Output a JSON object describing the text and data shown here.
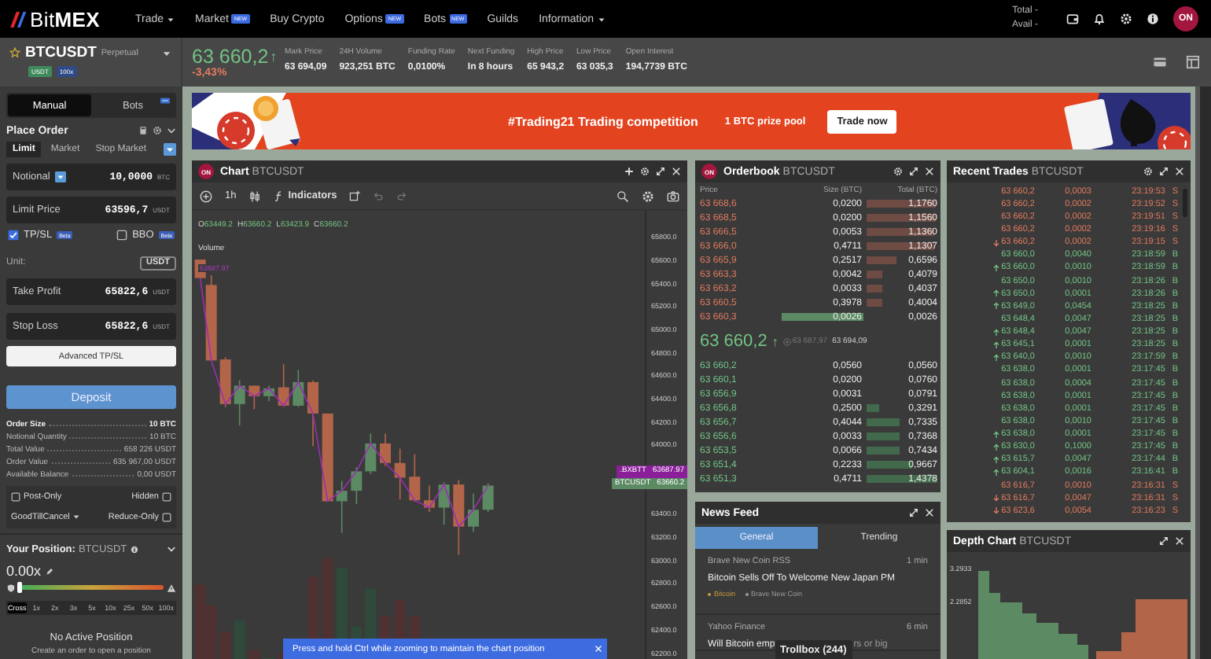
{
  "nav": {
    "logo": "Bit**MEX**",
    "items": [
      {
        "label": "Trade",
        "dropdown": true
      },
      {
        "label": "Market",
        "dropdown": false,
        "badge": "NEW"
      },
      {
        "label": "Buy Crypto",
        "dropdown": false
      },
      {
        "label": "Options",
        "dropdown": false,
        "badge": "NEW"
      },
      {
        "label": "Bots",
        "dropdown": false,
        "badge": "NEW"
      },
      {
        "label": "Guilds",
        "dropdown": false
      },
      {
        "label": "Information",
        "dropdown": true
      }
    ],
    "balances": [
      "Total -",
      "Avail -"
    ],
    "avatar": "ON"
  },
  "ticker": {
    "symbol": "BTCUSDT",
    "type": "Perpetual",
    "tags": [
      {
        "label": "USDT",
        "color": "#3f8a5c"
      },
      {
        "label": "100x",
        "color": "#2f4a86"
      }
    ],
    "price": "63 660,2",
    "rising": true,
    "arrow": "↑",
    "change": "-3,43%",
    "stats": [
      {
        "label": "Mark Price",
        "value": "63 694,09"
      },
      {
        "label": "24H Volume",
        "value": "923,251 BTC"
      },
      {
        "label": "Funding Rate",
        "value": "0,0100%"
      },
      {
        "label": "Next Funding",
        "value": "In 8 hours"
      },
      {
        "label": "High Price",
        "value": "65 943,2"
      },
      {
        "label": "Low Price",
        "value": "63 035,3"
      },
      {
        "label": "Open Interest",
        "value": "194,7739 BTC"
      }
    ]
  },
  "banner": {
    "title": "#Trading21 Trading competition",
    "prize": "1 BTC prize pool",
    "button": "Trade now"
  },
  "order": {
    "tabs": [
      {
        "label": "Manual",
        "selected": true
      },
      {
        "label": "Bots",
        "selected": false
      }
    ],
    "title": "Place Order",
    "types": [
      {
        "label": "Limit",
        "selected": true
      },
      {
        "label": "Market",
        "selected": false
      },
      {
        "label": "Stop Market",
        "selected": false
      }
    ],
    "fields": [
      {
        "label": "Notional",
        "value": "10,0000",
        "unit": "BTC",
        "dropdown": true
      },
      {
        "label": "Limit Price",
        "value": "63596,7",
        "unit": "USDT",
        "dropdown": false
      }
    ],
    "options": [
      {
        "label": "TP/SL",
        "checked": true,
        "badge": "Beta"
      },
      {
        "label": "BBO",
        "checked": false,
        "badge": "Beta"
      }
    ],
    "unit": {
      "label": "Unit:",
      "value": "USDT"
    },
    "tp_fields": [
      {
        "label": "Take Profit",
        "value": "65822,6",
        "unit": "USDT"
      },
      {
        "label": "Stop Loss",
        "value": "65822,6",
        "unit": "USDT"
      }
    ],
    "advanced_button": "Advanced TP/SL",
    "deposit_button": "Deposit",
    "summary": [
      {
        "label": "Order Size",
        "value": "10 BTC",
        "bold": true
      },
      {
        "label": "Notional Quantity",
        "value": "10 BTC",
        "bold": false
      },
      {
        "label": "Total Value",
        "value": "658 226 USDT",
        "bold": false
      },
      {
        "label": "Order Value",
        "value": "635 967,00 USDT",
        "bold": false
      },
      {
        "label": "Available Balance",
        "value": "0,00 USDT",
        "bold": false
      }
    ],
    "flags": [
      {
        "kind": "box-left",
        "label": "Post-Only",
        "checked": false
      },
      {
        "kind": "box-right",
        "label": "Hidden",
        "checked": false
      },
      {
        "kind": "dropdown",
        "label": "GoodTillCancel"
      },
      {
        "kind": "box-right",
        "label": "Reduce-Only",
        "checked": false
      }
    ]
  },
  "position": {
    "label": "Your Position:",
    "symbol": "BTCUSDT",
    "leverage": "0.00x",
    "level": 0,
    "leverage_options": [
      {
        "label": "Cross",
        "selected": true
      },
      {
        "label": "1x",
        "selected": false
      },
      {
        "label": "2x",
        "selected": false
      },
      {
        "label": "3x",
        "selected": false
      },
      {
        "label": "5x",
        "selected": false
      },
      {
        "label": "10x",
        "selected": false
      },
      {
        "label": "25x",
        "selected": false
      },
      {
        "label": "50x",
        "selected": false
      },
      {
        "label": "100x",
        "selected": false
      }
    ],
    "empty_title": "No Active Position",
    "empty_hint": "Create an order to open a position"
  },
  "chart": {
    "badge": "ON",
    "title": "Chart",
    "symbol": "BTCUSDT",
    "interval": "1h",
    "indicators": "Indicators",
    "ohlc": [
      {
        "key": "O",
        "value": "63449.2"
      },
      {
        "key": "H",
        "value": "63660.2"
      },
      {
        "key": "L",
        "value": "63423.9"
      },
      {
        "key": "C",
        "value": "63660.2"
      }
    ],
    "volume_label": "Volume",
    "marker": "63687.97",
    "axis": [
      "65800.0",
      "65600.0",
      "65400.0",
      "65200.0",
      "65000.0",
      "64800.0",
      "64600.0",
      "64400.0",
      "64200.0",
      "64000.0",
      "63400.0",
      "63200.0",
      "63000.0",
      "62800.0",
      "62600.0",
      "62400.0",
      "62200.0"
    ],
    "tags": [
      {
        "label": ".BXBTT",
        "value": "63687.97",
        "color": "#8a1f99"
      },
      {
        "label": "BTCUSDT",
        "value": "63660.2",
        "color": "#5b8a63"
      }
    ],
    "hint": "Press and hold Ctrl while zooming to maintain the chart position"
  },
  "orderbook": {
    "badge": "ON",
    "title": "Orderbook",
    "symbol": "BTCUSDT",
    "columns": [
      "Price",
      "Size (BTC)",
      "Total (BTC)"
    ],
    "asks": [
      {
        "price": "63 668,6",
        "size": "0,0200",
        "total": "1,1760",
        "own": false
      },
      {
        "price": "63 668,5",
        "size": "0,0200",
        "total": "1,1560",
        "own": false
      },
      {
        "price": "63 666,5",
        "size": "0,0053",
        "total": "1,1360",
        "own": false
      },
      {
        "price": "63 666,0",
        "size": "0,4711",
        "total": "1,1307",
        "own": false
      },
      {
        "price": "63 665,9",
        "size": "0,2517",
        "total": "0,6596",
        "own": false
      },
      {
        "price": "63 663,3",
        "size": "0,0042",
        "total": "0,4079",
        "own": false
      },
      {
        "price": "63 663,2",
        "size": "0,0033",
        "total": "0,4037",
        "own": false
      },
      {
        "price": "63 660,5",
        "size": "0,3978",
        "total": "0,4004",
        "own": false
      },
      {
        "price": "63 660,3",
        "size": "0,0026",
        "total": "0,0026",
        "own": true
      }
    ],
    "last": {
      "price": "63 660,2",
      "rising": true,
      "arrow": "↑",
      "index": "63 687,97",
      "mark": "63 694,09"
    },
    "bids": [
      {
        "price": "63 660,2",
        "size": "0,0560",
        "total": "0,0560"
      },
      {
        "price": "63 660,1",
        "size": "0,0200",
        "total": "0,0760"
      },
      {
        "price": "63 656,9",
        "size": "0,0031",
        "total": "0,0791"
      },
      {
        "price": "63 656,8",
        "size": "0,2500",
        "total": "0,3291"
      },
      {
        "price": "63 656,7",
        "size": "0,4044",
        "total": "0,7335"
      },
      {
        "price": "63 656,6",
        "size": "0,0033",
        "total": "0,7368"
      },
      {
        "price": "63 653,5",
        "size": "0,0066",
        "total": "0,7434"
      },
      {
        "price": "63 651,4",
        "size": "0,2233",
        "total": "0,9667"
      },
      {
        "price": "63 651,3",
        "size": "0,4711",
        "total": "1,4378"
      }
    ]
  },
  "news": {
    "title": "News Feed",
    "tabs": [
      {
        "label": "General",
        "selected": true
      },
      {
        "label": "Trending",
        "selected": false
      }
    ],
    "items": [
      {
        "source": "Brave New Coin RSS",
        "age": "1 min",
        "title": "Bitcoin Sells Off To Welcome New Japan PM",
        "tags": [
          {
            "label": "Bitcoin",
            "color": "#c99a3e"
          },
          {
            "label": "Brave New Coin",
            "color": "#9a9a9a"
          }
        ]
      },
      {
        "source": "Yahoo Finance",
        "age": "6 min",
        "title": "Will Bitcoin emp",
        "title_after": "rs or big"
      }
    ]
  },
  "trollbox": "Trollbox (244)",
  "trades": {
    "title": "Recent Trades",
    "symbol": "BTCUSDT",
    "rows": [
      {
        "price": "63 660,2",
        "size": "0,0003",
        "time": "23:19:53",
        "side": "S",
        "kind": "sell",
        "tick": false
      },
      {
        "price": "63 660,2",
        "size": "0,0002",
        "time": "23:19:52",
        "side": "S",
        "kind": "sell",
        "tick": false
      },
      {
        "price": "63 660,2",
        "size": "0,0002",
        "time": "23:19:51",
        "side": "S",
        "kind": "sell",
        "tick": false
      },
      {
        "price": "63 660,2",
        "size": "0,0002",
        "time": "23:19:16",
        "side": "S",
        "kind": "sell",
        "tick": false
      },
      {
        "price": "63 660,2",
        "size": "0,0002",
        "time": "23:19:15",
        "side": "S",
        "kind": "sell",
        "tick": true
      },
      {
        "price": "63 660,0",
        "size": "0,0040",
        "time": "23:18:59",
        "side": "B",
        "kind": "buy",
        "tick": false
      },
      {
        "price": "63 660,0",
        "size": "0,0010",
        "time": "23:18:59",
        "side": "B",
        "kind": "buy",
        "tick": true
      },
      {
        "price": "63 650,0",
        "size": "0,0010",
        "time": "23:18:26",
        "side": "B",
        "kind": "buy",
        "tick": false
      },
      {
        "price": "63 650,0",
        "size": "0,0001",
        "time": "23:18:26",
        "side": "B",
        "kind": "buy",
        "tick": true
      },
      {
        "price": "63 649,0",
        "size": "0,0454",
        "time": "23:18:25",
        "side": "B",
        "kind": "buy",
        "tick": true
      },
      {
        "price": "63 648,4",
        "size": "0,0047",
        "time": "23:18:25",
        "side": "B",
        "kind": "buy",
        "tick": false
      },
      {
        "price": "63 648,4",
        "size": "0,0047",
        "time": "23:18:25",
        "side": "B",
        "kind": "buy",
        "tick": true
      },
      {
        "price": "63 645,1",
        "size": "0,0001",
        "time": "23:18:25",
        "side": "B",
        "kind": "buy",
        "tick": true
      },
      {
        "price": "63 640,0",
        "size": "0,0010",
        "time": "23:17:59",
        "side": "B",
        "kind": "buy",
        "tick": true
      },
      {
        "price": "63 638,0",
        "size": "0,0001",
        "time": "23:17:45",
        "side": "B",
        "kind": "buy",
        "tick": false
      },
      {
        "price": "63 638,0",
        "size": "0,0004",
        "time": "23:17:45",
        "side": "B",
        "kind": "buy",
        "tick": false
      },
      {
        "price": "63 638,0",
        "size": "0,0001",
        "time": "23:17:45",
        "side": "B",
        "kind": "buy",
        "tick": false
      },
      {
        "price": "63 638,0",
        "size": "0,0001",
        "time": "23:17:45",
        "side": "B",
        "kind": "buy",
        "tick": false
      },
      {
        "price": "63 638,0",
        "size": "0,0010",
        "time": "23:17:45",
        "side": "B",
        "kind": "buy",
        "tick": false
      },
      {
        "price": "63 638,0",
        "size": "0,0001",
        "time": "23:17:45",
        "side": "B",
        "kind": "buy",
        "tick": true
      },
      {
        "price": "63 630,0",
        "size": "0,1000",
        "time": "23:17:45",
        "side": "B",
        "kind": "buy",
        "tick": true
      },
      {
        "price": "63 615,7",
        "size": "0,0047",
        "time": "23:17:44",
        "side": "B",
        "kind": "buy",
        "tick": true
      },
      {
        "price": "63 604,1",
        "size": "0,0016",
        "time": "23:16:41",
        "side": "B",
        "kind": "buy",
        "tick": true
      },
      {
        "price": "63 616,7",
        "size": "0,0010",
        "time": "23:16:31",
        "side": "S",
        "kind": "sell",
        "tick": false
      },
      {
        "price": "63 616,7",
        "size": "0,0047",
        "time": "23:16:31",
        "side": "S",
        "kind": "sell",
        "tick": true
      },
      {
        "price": "63 623,6",
        "size": "0,0054",
        "time": "23:16:23",
        "side": "S",
        "kind": "sell",
        "tick": true
      }
    ]
  },
  "depth": {
    "title": "Depth Chart",
    "symbol": "BTCUSDT",
    "ticks": [
      "3.2933",
      "2.2852"
    ]
  }
}
